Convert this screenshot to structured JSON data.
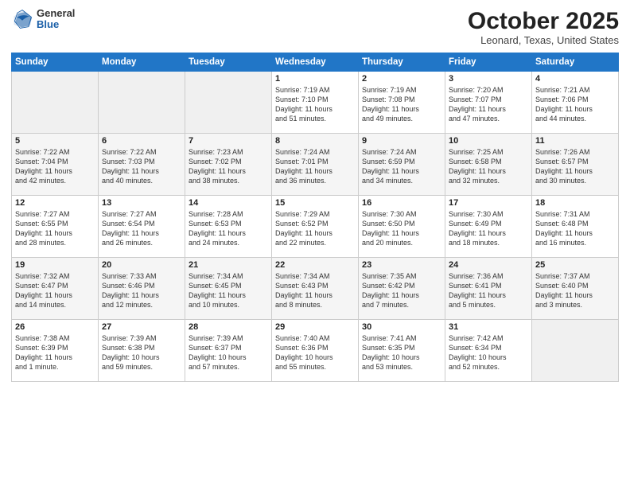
{
  "logo": {
    "general": "General",
    "blue": "Blue"
  },
  "header": {
    "month": "October 2025",
    "location": "Leonard, Texas, United States"
  },
  "days_of_week": [
    "Sunday",
    "Monday",
    "Tuesday",
    "Wednesday",
    "Thursday",
    "Friday",
    "Saturday"
  ],
  "weeks": [
    [
      {
        "num": "",
        "info": ""
      },
      {
        "num": "",
        "info": ""
      },
      {
        "num": "",
        "info": ""
      },
      {
        "num": "1",
        "info": "Sunrise: 7:19 AM\nSunset: 7:10 PM\nDaylight: 11 hours\nand 51 minutes."
      },
      {
        "num": "2",
        "info": "Sunrise: 7:19 AM\nSunset: 7:08 PM\nDaylight: 11 hours\nand 49 minutes."
      },
      {
        "num": "3",
        "info": "Sunrise: 7:20 AM\nSunset: 7:07 PM\nDaylight: 11 hours\nand 47 minutes."
      },
      {
        "num": "4",
        "info": "Sunrise: 7:21 AM\nSunset: 7:06 PM\nDaylight: 11 hours\nand 44 minutes."
      }
    ],
    [
      {
        "num": "5",
        "info": "Sunrise: 7:22 AM\nSunset: 7:04 PM\nDaylight: 11 hours\nand 42 minutes."
      },
      {
        "num": "6",
        "info": "Sunrise: 7:22 AM\nSunset: 7:03 PM\nDaylight: 11 hours\nand 40 minutes."
      },
      {
        "num": "7",
        "info": "Sunrise: 7:23 AM\nSunset: 7:02 PM\nDaylight: 11 hours\nand 38 minutes."
      },
      {
        "num": "8",
        "info": "Sunrise: 7:24 AM\nSunset: 7:01 PM\nDaylight: 11 hours\nand 36 minutes."
      },
      {
        "num": "9",
        "info": "Sunrise: 7:24 AM\nSunset: 6:59 PM\nDaylight: 11 hours\nand 34 minutes."
      },
      {
        "num": "10",
        "info": "Sunrise: 7:25 AM\nSunset: 6:58 PM\nDaylight: 11 hours\nand 32 minutes."
      },
      {
        "num": "11",
        "info": "Sunrise: 7:26 AM\nSunset: 6:57 PM\nDaylight: 11 hours\nand 30 minutes."
      }
    ],
    [
      {
        "num": "12",
        "info": "Sunrise: 7:27 AM\nSunset: 6:55 PM\nDaylight: 11 hours\nand 28 minutes."
      },
      {
        "num": "13",
        "info": "Sunrise: 7:27 AM\nSunset: 6:54 PM\nDaylight: 11 hours\nand 26 minutes."
      },
      {
        "num": "14",
        "info": "Sunrise: 7:28 AM\nSunset: 6:53 PM\nDaylight: 11 hours\nand 24 minutes."
      },
      {
        "num": "15",
        "info": "Sunrise: 7:29 AM\nSunset: 6:52 PM\nDaylight: 11 hours\nand 22 minutes."
      },
      {
        "num": "16",
        "info": "Sunrise: 7:30 AM\nSunset: 6:50 PM\nDaylight: 11 hours\nand 20 minutes."
      },
      {
        "num": "17",
        "info": "Sunrise: 7:30 AM\nSunset: 6:49 PM\nDaylight: 11 hours\nand 18 minutes."
      },
      {
        "num": "18",
        "info": "Sunrise: 7:31 AM\nSunset: 6:48 PM\nDaylight: 11 hours\nand 16 minutes."
      }
    ],
    [
      {
        "num": "19",
        "info": "Sunrise: 7:32 AM\nSunset: 6:47 PM\nDaylight: 11 hours\nand 14 minutes."
      },
      {
        "num": "20",
        "info": "Sunrise: 7:33 AM\nSunset: 6:46 PM\nDaylight: 11 hours\nand 12 minutes."
      },
      {
        "num": "21",
        "info": "Sunrise: 7:34 AM\nSunset: 6:45 PM\nDaylight: 11 hours\nand 10 minutes."
      },
      {
        "num": "22",
        "info": "Sunrise: 7:34 AM\nSunset: 6:43 PM\nDaylight: 11 hours\nand 8 minutes."
      },
      {
        "num": "23",
        "info": "Sunrise: 7:35 AM\nSunset: 6:42 PM\nDaylight: 11 hours\nand 7 minutes."
      },
      {
        "num": "24",
        "info": "Sunrise: 7:36 AM\nSunset: 6:41 PM\nDaylight: 11 hours\nand 5 minutes."
      },
      {
        "num": "25",
        "info": "Sunrise: 7:37 AM\nSunset: 6:40 PM\nDaylight: 11 hours\nand 3 minutes."
      }
    ],
    [
      {
        "num": "26",
        "info": "Sunrise: 7:38 AM\nSunset: 6:39 PM\nDaylight: 11 hours\nand 1 minute."
      },
      {
        "num": "27",
        "info": "Sunrise: 7:39 AM\nSunset: 6:38 PM\nDaylight: 10 hours\nand 59 minutes."
      },
      {
        "num": "28",
        "info": "Sunrise: 7:39 AM\nSunset: 6:37 PM\nDaylight: 10 hours\nand 57 minutes."
      },
      {
        "num": "29",
        "info": "Sunrise: 7:40 AM\nSunset: 6:36 PM\nDaylight: 10 hours\nand 55 minutes."
      },
      {
        "num": "30",
        "info": "Sunrise: 7:41 AM\nSunset: 6:35 PM\nDaylight: 10 hours\nand 53 minutes."
      },
      {
        "num": "31",
        "info": "Sunrise: 7:42 AM\nSunset: 6:34 PM\nDaylight: 10 hours\nand 52 minutes."
      },
      {
        "num": "",
        "info": ""
      }
    ]
  ]
}
